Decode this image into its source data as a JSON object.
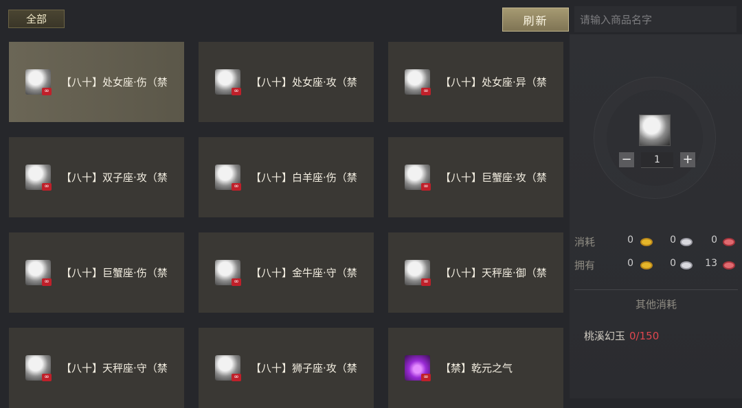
{
  "toolbar": {
    "filter_tab": "全部",
    "refresh_label": "刷新",
    "search_placeholder": "请输入商品名字"
  },
  "items": [
    {
      "name": "【八十】处女座·伤（禁",
      "badge": "∞",
      "icon": "constellation-virgo-icon",
      "selected": true
    },
    {
      "name": "【八十】处女座·攻（禁",
      "badge": "∞",
      "icon": "constellation-virgo-icon"
    },
    {
      "name": "【八十】处女座·异（禁",
      "badge": "∞",
      "icon": "constellation-virgo-icon"
    },
    {
      "name": "【八十】双子座·攻（禁",
      "badge": "∞",
      "icon": "constellation-gemini-icon"
    },
    {
      "name": "【八十】白羊座·伤（禁",
      "badge": "∞",
      "icon": "constellation-aries-icon"
    },
    {
      "name": "【八十】巨蟹座·攻（禁",
      "badge": "∞",
      "icon": "constellation-cancer-icon"
    },
    {
      "name": "【八十】巨蟹座·伤（禁",
      "badge": "∞",
      "icon": "constellation-cancer-icon"
    },
    {
      "name": "【八十】金牛座·守（禁",
      "badge": "∞",
      "icon": "constellation-taurus-icon"
    },
    {
      "name": "【八十】天秤座·御（禁",
      "badge": "∞",
      "icon": "constellation-libra-icon"
    },
    {
      "name": "【八十】天秤座·守（禁",
      "badge": "∞",
      "icon": "constellation-libra-icon"
    },
    {
      "name": "【八十】狮子座·攻（禁",
      "badge": "∞",
      "icon": "constellation-leo-icon"
    },
    {
      "name": "【禁】乾元之气",
      "badge": "∞",
      "icon": "qianyuan-qi-icon"
    }
  ],
  "detail": {
    "quantity": "1",
    "minus": "−",
    "plus": "+",
    "cost_label": "消耗",
    "own_label": "拥有",
    "cost": [
      "0",
      "0",
      "0"
    ],
    "own": [
      "0",
      "0",
      "13"
    ],
    "other_title": "其他消耗",
    "other_item_name": "桃溪幻玉",
    "other_item_count": "0/150"
  },
  "colors": {
    "background": "#26272b",
    "card": "#3a3834",
    "accent_gold": "#a69a72",
    "count_red": "#e0474f"
  }
}
